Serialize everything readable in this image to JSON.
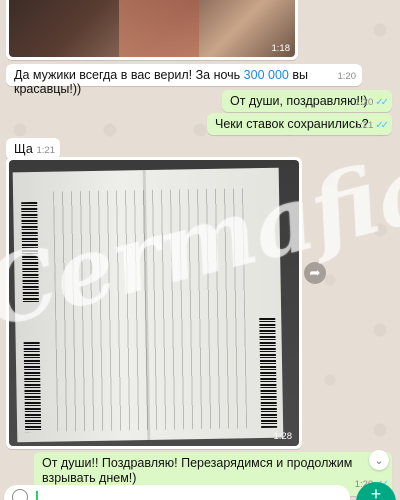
{
  "messages": {
    "img_top": {
      "time": "1:18"
    },
    "m1": {
      "text_before": "Да мужики всегда в вас верил! За ночь ",
      "highlight": "300 000",
      "text_after": " вы красавцы!))",
      "time": "1:20"
    },
    "m2": {
      "text": "От души, поздравляю!!)",
      "time": "1:20"
    },
    "m3": {
      "text": "Чеки ставок сохранились?",
      "time": "1:21"
    },
    "m4": {
      "text": "Ща",
      "time": "1:21"
    },
    "img_main": {
      "time": "1:28"
    },
    "m5": {
      "text": "От души!! Поздравляю! Перезарядимся и продолжим взрывать днем!)",
      "time": "1:29"
    }
  },
  "watermark": {
    "text": "Cermafia"
  },
  "icons": {
    "read_ticks": "✓✓",
    "forward": "➦",
    "scroll_down": "⌄",
    "send": "+"
  },
  "colors": {
    "chat_background": "#e6ddd4",
    "outgoing_bubble": "#dcf8c6",
    "incoming_bubble": "#ffffff",
    "link_number": "#1e88e5",
    "read_ticks": "#4fc3f7",
    "send_button": "#00a884"
  }
}
